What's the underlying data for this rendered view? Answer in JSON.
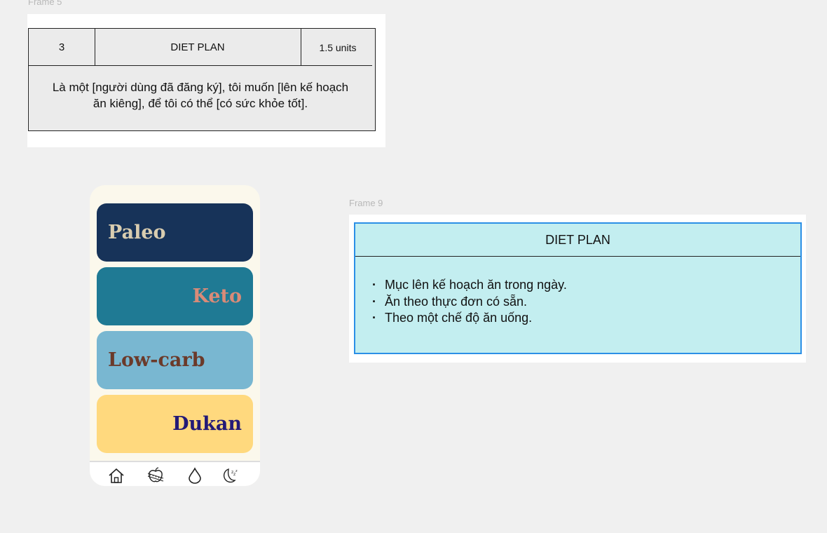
{
  "frames": {
    "frame5_label": "Frame 5",
    "frame9_label": "Frame 9"
  },
  "story_card": {
    "number": "3",
    "title": "DIET PLAN",
    "units": "1.5 units",
    "story": "Là một [người dùng đã đăng ký], tôi muốn [lên kế hoạch ăn kiêng], để tôi có thể [có sức khỏe tốt]."
  },
  "phone": {
    "diets": [
      {
        "label": "Paleo",
        "bg": "#173359",
        "color": "#d9cdb0"
      },
      {
        "label": "Keto",
        "bg": "#1f7a94",
        "color": "#d98b78"
      },
      {
        "label": "Low-carb",
        "bg": "#79b7d1",
        "color": "#6b3a2a"
      },
      {
        "label": "Dukan",
        "bg": "#ffd97e",
        "color": "#231a77"
      }
    ],
    "nav_icons": [
      "home-icon",
      "apple-tape-measure-icon",
      "water-drop-icon",
      "moon-sleep-icon"
    ]
  },
  "feature_card": {
    "title": "DIET PLAN",
    "bullets": [
      "Mục lên kế hoạch ăn trong ngày.",
      "Ăn theo thực đơn có sẵn.",
      "Theo một chế độ ăn uống."
    ]
  }
}
